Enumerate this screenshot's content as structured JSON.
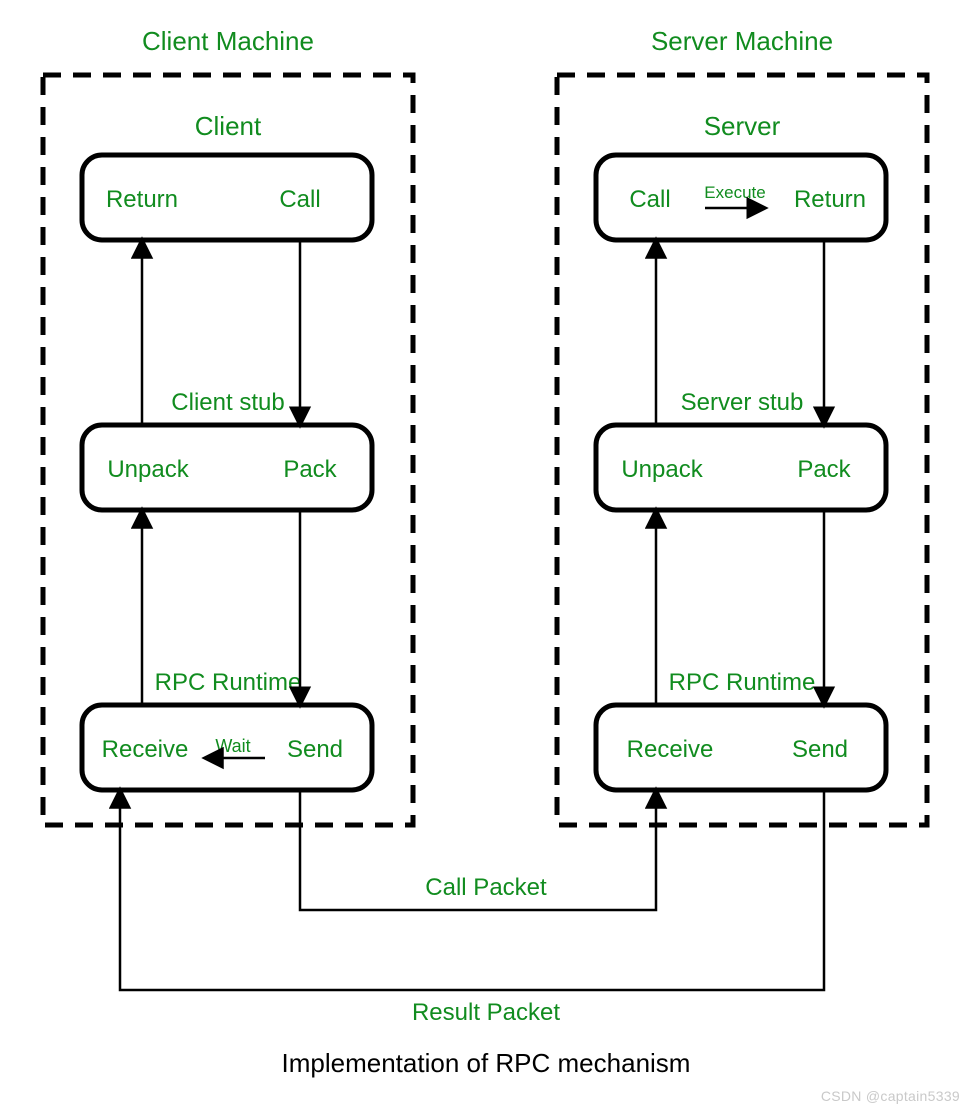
{
  "title": "Implementation of RPC mechanism",
  "watermark": "CSDN @captain5339",
  "client_machine": {
    "title": "Client Machine",
    "client": {
      "title": "Client",
      "left": "Return",
      "right": "Call"
    },
    "stub": {
      "title": "Client stub",
      "left": "Unpack",
      "right": "Pack"
    },
    "runtime": {
      "title": "RPC Runtime",
      "left": "Receive",
      "right": "Send",
      "mid": "Wait"
    }
  },
  "server_machine": {
    "title": "Server Machine",
    "server": {
      "title": "Server",
      "left": "Call",
      "right": "Return",
      "mid": "Execute"
    },
    "stub": {
      "title": "Server stub",
      "left": "Unpack",
      "right": "Pack"
    },
    "runtime": {
      "title": "RPC Runtime",
      "left": "Receive",
      "right": "Send"
    }
  },
  "packets": {
    "call": "Call Packet",
    "result": "Result Packet"
  }
}
